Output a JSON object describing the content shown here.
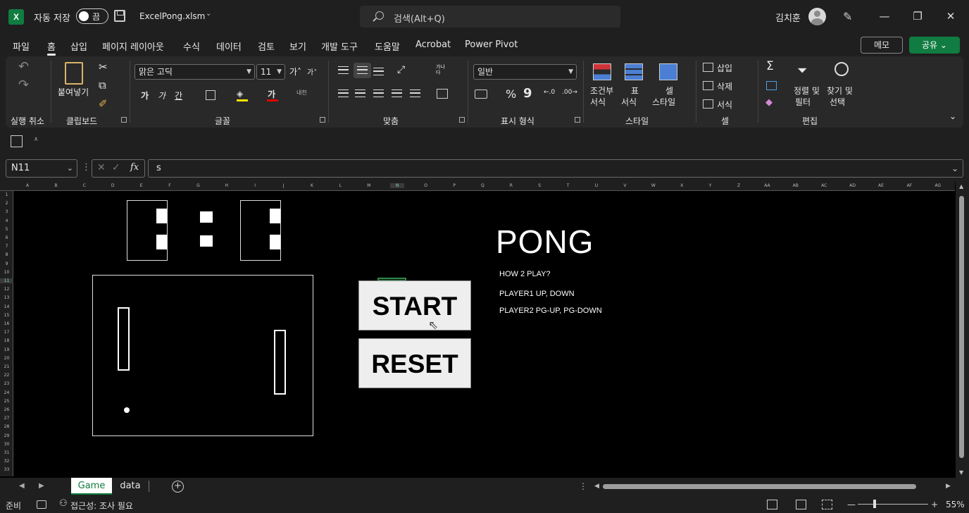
{
  "titlebar": {
    "app_icon": "X",
    "autosave_label": "자동 저장",
    "autosave_toggle": "끔",
    "filename": "ExcelPong.xlsm",
    "search_placeholder": "검색(Alt+Q)",
    "username": "김치훈"
  },
  "menu": {
    "tabs": [
      "파일",
      "홈",
      "삽입",
      "페이지 레이아웃",
      "수식",
      "데이터",
      "검토",
      "보기",
      "개발 도구",
      "도움말",
      "Acrobat",
      "Power Pivot"
    ],
    "active_tab": "홈",
    "memo_label": "메모",
    "share_label": "공유"
  },
  "ribbon": {
    "groups": {
      "undo": "실행 취소",
      "clipboard": "클립보드",
      "font": "글꼴",
      "align": "맞춤",
      "number": "표시 형식",
      "styles": "스타일",
      "cells": "셀",
      "editing": "편집"
    },
    "paste_label": "붙여넣기",
    "font_name": "맑은 고딕",
    "font_size": "11",
    "number_format": "일반",
    "conditional_label_1": "조건부",
    "conditional_label_2": "서식",
    "table_label_1": "표",
    "table_label_2": "서식",
    "cellstyle_label_1": "셀",
    "cellstyle_label_2": "스타일",
    "insert_label": "삽입",
    "delete_label": "삭제",
    "format_label": "서식",
    "sort_label_1": "정렬 및",
    "sort_label_2": "필터",
    "find_label_1": "찾기 및",
    "find_label_2": "선택",
    "font_grow": "가",
    "font_shrink": "가",
    "bold": "가",
    "italic": "가",
    "underline": "간",
    "font_color": "가",
    "wrap_text": "가나\n다",
    "percent": "%",
    "comma": "9",
    "phonetic": "내천"
  },
  "formula_bar": {
    "name_box": "N11",
    "formula": "s",
    "fx": "fx"
  },
  "sheet": {
    "columns": [
      "A",
      "B",
      "C",
      "D",
      "E",
      "F",
      "G",
      "H",
      "I",
      "J",
      "K",
      "L",
      "M",
      "N",
      "O",
      "P",
      "Q",
      "R",
      "S",
      "T",
      "U",
      "V",
      "W",
      "X",
      "Y",
      "Z",
      "AA",
      "AB",
      "AC",
      "AD",
      "AE",
      "AF",
      "AG"
    ],
    "rows": [
      "1",
      "2",
      "3",
      "4",
      "5",
      "6",
      "7",
      "8",
      "9",
      "10",
      "11",
      "12",
      "13",
      "14",
      "15",
      "16",
      "17",
      "18",
      "19",
      "20",
      "21",
      "22",
      "23",
      "24",
      "25",
      "26",
      "27",
      "28",
      "29",
      "30",
      "31",
      "32",
      "33"
    ],
    "score_left": "1",
    "score_right": "1",
    "title": "PONG",
    "how_to": "HOW 2 PLAY?",
    "player1": "PLAYER1 UP, DOWN",
    "player2": "PLAYER2 PG-UP, PG-DOWN",
    "start_button": "START",
    "reset_button": "RESET"
  },
  "tabs": {
    "sheets": [
      "Game",
      "data"
    ],
    "active": "Game"
  },
  "status": {
    "ready": "준비",
    "accessibility": "접근성: 조사 필요",
    "zoom": "55%"
  }
}
